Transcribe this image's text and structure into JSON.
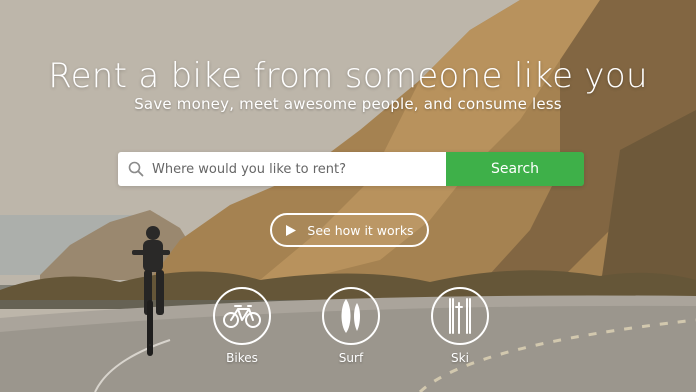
{
  "hero": {
    "headline": "Rent a bike from someone like you",
    "subline": "Save money, meet awesome people, and consume less"
  },
  "search": {
    "placeholder": "Where would you like to rent?",
    "button_label": "Search",
    "button_color": "#3eb049"
  },
  "how_it_works": {
    "label": "See how it works",
    "icon": "play-icon"
  },
  "categories": [
    {
      "label": "Bikes",
      "icon": "bicycle-icon"
    },
    {
      "label": "Surf",
      "icon": "surfboard-icon"
    },
    {
      "label": "Ski",
      "icon": "ski-icon"
    }
  ]
}
